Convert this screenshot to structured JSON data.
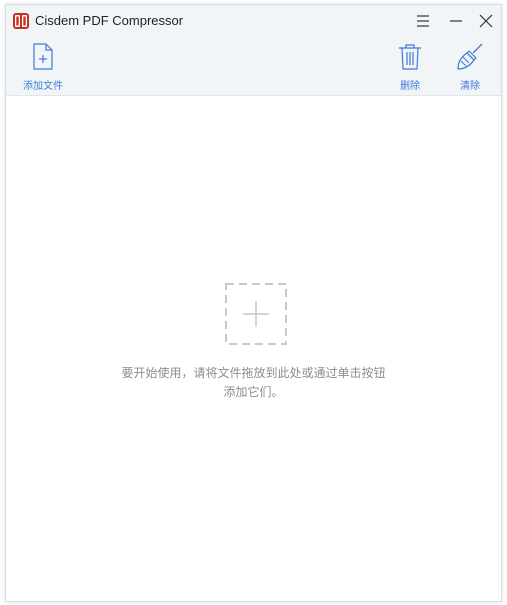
{
  "window": {
    "title": "Cisdem PDF Compressor",
    "app_icon": "cisdem-app-icon",
    "controls": [
      "menu-icon",
      "minimize-icon",
      "close-icon"
    ]
  },
  "toolbar": {
    "add_file_label": "添加文件",
    "delete_label": "删除",
    "clear_label": "清除"
  },
  "main": {
    "drop_hint_line1": "要开始使用，请将文件拖放到此处或通过单击按钮",
    "drop_hint_line2": "添加它们。"
  },
  "colors": {
    "accent": "#3c7bd8",
    "toolbar_bg": "#f2f5f8",
    "app_icon_red": "#c8301e",
    "hint_text": "#8a8d92",
    "drop_box_dash": "#c9c9c9"
  }
}
